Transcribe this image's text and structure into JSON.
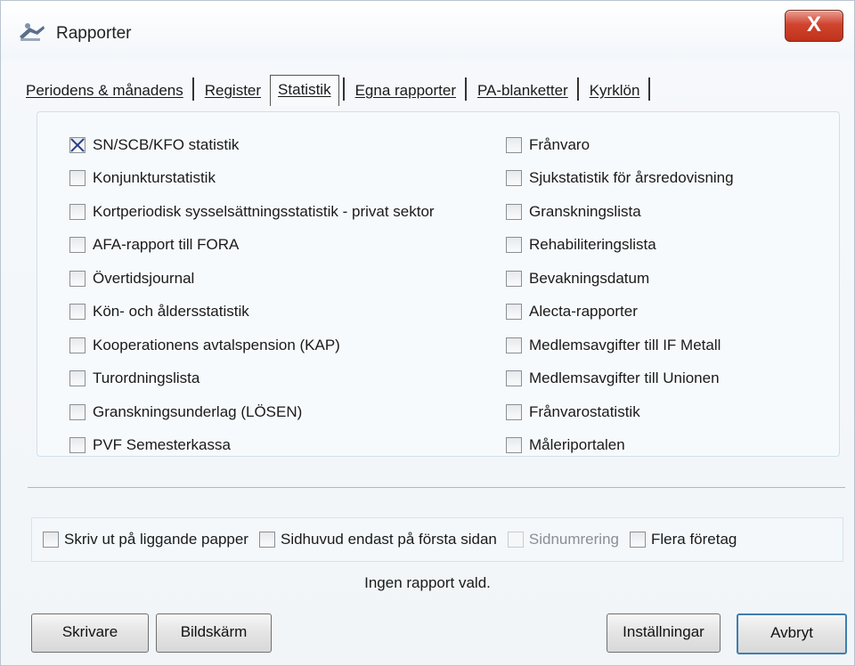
{
  "window": {
    "title": "Rapporter",
    "close_label": "X"
  },
  "tabs": [
    {
      "label": "Periodens & månadens",
      "active": false
    },
    {
      "label": "Register",
      "active": false
    },
    {
      "label": "Statistik",
      "active": true
    },
    {
      "label": "Egna rapporter",
      "active": false
    },
    {
      "label": "PA-blanketter",
      "active": false
    },
    {
      "label": "Kyrklön",
      "active": false
    }
  ],
  "reports_left": [
    {
      "label": "SN/SCB/KFO statistik",
      "checked": true
    },
    {
      "label": "Konjunkturstatistik",
      "checked": false
    },
    {
      "label": "Kortperiodisk sysselsättningsstatistik - privat sektor",
      "checked": false
    },
    {
      "label": "AFA-rapport till FORA",
      "checked": false
    },
    {
      "label": "Övertidsjournal",
      "checked": false
    },
    {
      "label": "Kön- och åldersstatistik",
      "checked": false
    },
    {
      "label": "Kooperationens avtalspension (KAP)",
      "checked": false
    },
    {
      "label": "Turordningslista",
      "checked": false
    },
    {
      "label": "Granskningsunderlag (LÖSEN)",
      "checked": false
    },
    {
      "label": "PVF Semesterkassa",
      "checked": false
    }
  ],
  "reports_right": [
    {
      "label": "Frånvaro",
      "checked": false
    },
    {
      "label": "Sjukstatistik för årsredovisning",
      "checked": false
    },
    {
      "label": "Granskningslista",
      "checked": false
    },
    {
      "label": "Rehabiliteringslista",
      "checked": false
    },
    {
      "label": "Bevakningsdatum",
      "checked": false
    },
    {
      "label": "Alecta-rapporter",
      "checked": false
    },
    {
      "label": "Medlemsavgifter till IF Metall",
      "checked": false
    },
    {
      "label": "Medlemsavgifter till Unionen",
      "checked": false
    },
    {
      "label": "Frånvarostatistik",
      "checked": false
    },
    {
      "label": "Måleriportalen",
      "checked": false
    }
  ],
  "options": {
    "landscape": "Skriv ut på liggande papper",
    "header_first_page": "Sidhuvud endast på första sidan",
    "page_numbering": "Sidnumrering",
    "multiple_companies": "Flera företag"
  },
  "status": "Ingen rapport vald.",
  "buttons": {
    "printer": "Skrivare",
    "screen": "Bildskärm",
    "settings": "Inställningar",
    "cancel": "Avbryt"
  },
  "colors": {
    "close_button": "#c0321c",
    "checkmark": "#2a3c8a",
    "default_button_border": "#3c7fb1"
  }
}
